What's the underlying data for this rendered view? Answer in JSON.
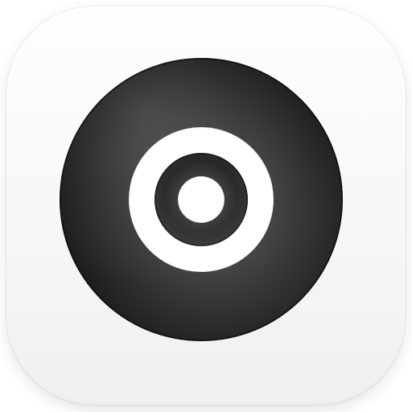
{
  "app_icon": {
    "icon": "cd-disc-icon",
    "colors": {
      "tile_top": "#fefefe",
      "tile_bottom": "#efefef",
      "disc_outer_dark": "#1a1a1a",
      "disc_outer_mid": "#3a3a3a",
      "disc_outer_light": "#5a5a5a",
      "ring_white": "#ffffff",
      "hub_dark": "#111111",
      "hub_highlight": "#6a6a6a",
      "center_hole": "#ffffff"
    }
  }
}
